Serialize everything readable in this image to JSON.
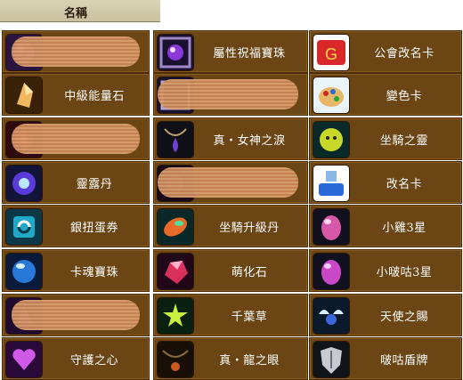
{
  "header": {
    "title": "名稱"
  },
  "columns": [
    {
      "rows": [
        {
          "label": "",
          "icon": "purple-orb-icon",
          "redacted": true
        },
        {
          "label": "中級能量石",
          "icon": "crystal-icon",
          "redacted": false
        },
        {
          "label": "",
          "icon": "red-gem-icon",
          "redacted": true
        },
        {
          "label": "靈露丹",
          "icon": "blue-orb-icon",
          "redacted": false
        },
        {
          "label": "銀扭蛋券",
          "icon": "cycle-ticket-icon",
          "redacted": false
        },
        {
          "label": "卡魂寶珠",
          "icon": "card-orb-icon",
          "redacted": false
        },
        {
          "label": "",
          "icon": "purple-shard-icon",
          "redacted": true
        },
        {
          "label": "守護之心",
          "icon": "guardian-heart-icon",
          "redacted": false
        }
      ]
    },
    {
      "rows": [
        {
          "label": "屬性祝福寶珠",
          "icon": "attribute-orb-icon",
          "redacted": false
        },
        {
          "label": "",
          "icon": "ornate-frame-icon",
          "redacted": true
        },
        {
          "label": "真・女神之淚",
          "icon": "goddess-tear-icon",
          "redacted": false
        },
        {
          "label": "",
          "icon": "dark-gem-icon",
          "redacted": true
        },
        {
          "label": "坐騎升級丹",
          "icon": "mount-pill-icon",
          "redacted": false
        },
        {
          "label": "萌化石",
          "icon": "cute-stone-icon",
          "redacted": false
        },
        {
          "label": "千葉草",
          "icon": "star-grass-icon",
          "redacted": false
        },
        {
          "label": "真・龍之眼",
          "icon": "dragon-eye-icon",
          "redacted": false
        }
      ]
    },
    {
      "rows": [
        {
          "label": "公會改名卡",
          "icon": "guild-rename-card-icon",
          "redacted": false
        },
        {
          "label": "變色卡",
          "icon": "palette-icon",
          "redacted": false
        },
        {
          "label": "坐騎之靈",
          "icon": "mount-spirit-icon",
          "redacted": false
        },
        {
          "label": "改名卡",
          "icon": "rename-card-icon",
          "redacted": false
        },
        {
          "label": "小雞3星",
          "icon": "chick-egg-icon",
          "redacted": false
        },
        {
          "label": "小啵咕3星",
          "icon": "pink-egg-icon",
          "redacted": false
        },
        {
          "label": "天使之賜",
          "icon": "angel-gift-icon",
          "redacted": false
        },
        {
          "label": "啵咕盾牌",
          "icon": "shield-icon",
          "redacted": false
        }
      ]
    }
  ]
}
